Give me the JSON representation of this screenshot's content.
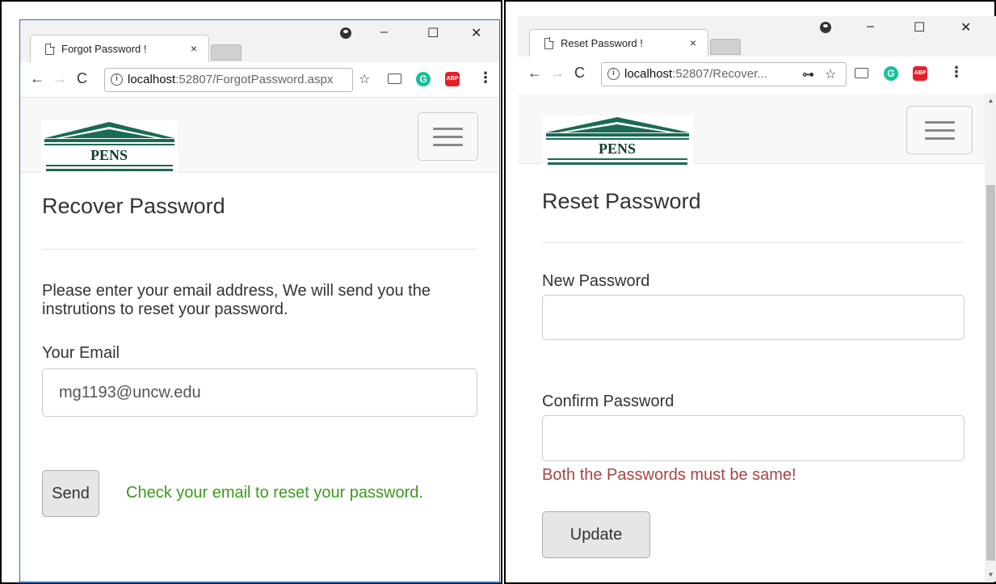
{
  "left_window": {
    "tab_title": "Forgot Password !",
    "tab_close": "×",
    "window_controls": {
      "minimize": "–",
      "maximize": "☐",
      "close": "✕"
    },
    "address": {
      "host": "localhost",
      "path": ":52807/ForgotPassword.aspx"
    },
    "nav": {
      "back": "←",
      "forward": "→",
      "reload": "C"
    },
    "bookmark": "☆",
    "page": {
      "brand": "PENS",
      "heading": "Recover Password",
      "instructions": "Please enter your email address, We will send you the instrutions to reset your password.",
      "email_label": "Your Email",
      "email_value": "mg1193@uncw.edu",
      "send_button": "Send",
      "success_message": "Check your email to reset your password."
    }
  },
  "right_window": {
    "tab_title": "Reset Password !",
    "tab_close": "×",
    "window_controls": {
      "minimize": "–",
      "maximize": "☐",
      "close": "✕"
    },
    "address": {
      "host": "localhost",
      "path": ":52807/Recover..."
    },
    "nav": {
      "back": "←",
      "forward": "→",
      "reload": "C"
    },
    "key_icon": "⊶",
    "bookmark": "☆",
    "page": {
      "brand": "PENS",
      "heading": "Reset Password",
      "new_password_label": "New Password",
      "new_password_value": "",
      "confirm_password_label": "Confirm Password",
      "confirm_password_value": "",
      "error_message": "Both the Passwords must be same!",
      "update_button": "Update"
    }
  },
  "colors": {
    "success": "#3c9a1e",
    "error": "#a94442",
    "logo_green": "#1a6a55"
  }
}
